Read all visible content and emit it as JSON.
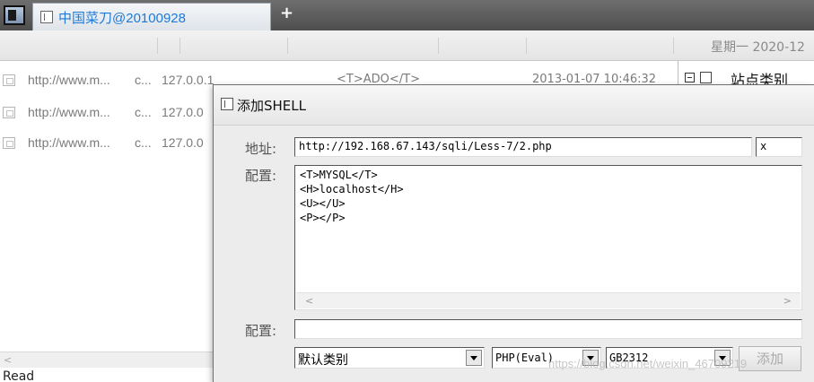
{
  "tab": {
    "title": "中国菜刀@20100928",
    "add_label": "+"
  },
  "header": {
    "date": "星期一 2020-12"
  },
  "rows": [
    {
      "url": "http://www.m...",
      "code": "c...",
      "ip": "127.0.0.1",
      "db": "<T>ADO</T>",
      "time": "2013-01-07 10:46:32"
    },
    {
      "url": "http://www.m...",
      "code": "c...",
      "ip": "127.0.0"
    },
    {
      "url": "http://www.m...",
      "code": "c...",
      "ip": "127.0.0"
    }
  ],
  "sidebar": {
    "title": "站点类别"
  },
  "status": {
    "text": "Read"
  },
  "dialog": {
    "title": "添加SHELL",
    "address_label": "地址:",
    "address_value": "http://192.168.67.143/sqli/Less-7/2.php",
    "password_value": "x",
    "config_label": "配置:",
    "config_lines": "<T>MYSQL</T>\n<H>localhost</H>\n<U></U>\n<P></P>",
    "config2_label": "配置:",
    "config2_value": "",
    "category_value": "默认类别",
    "type_value": "PHP(Eval)",
    "encoding_value": "GB2312",
    "add_button": "添加"
  },
  "watermark": "https://blog.csdn.net/weixin_46709219"
}
